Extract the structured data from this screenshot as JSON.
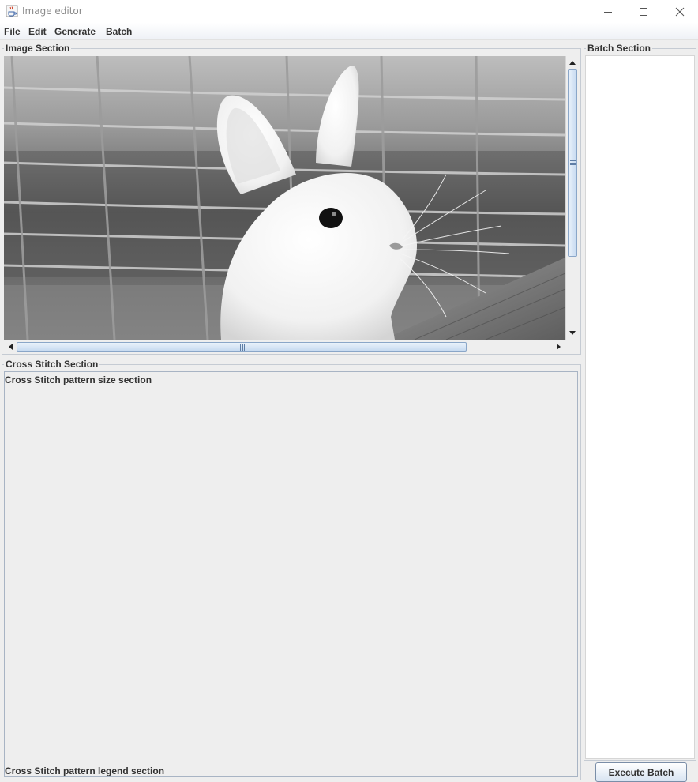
{
  "window": {
    "title": "Image editor",
    "icon": "java-coffee-icon"
  },
  "window_controls": [
    "minimize-icon",
    "maximize-icon",
    "close-icon"
  ],
  "menu": [
    "File",
    "Edit",
    "Generate",
    "Batch"
  ],
  "image_section": {
    "title": "Image Section",
    "image_description": "grayscale-white-rabbit",
    "vertical_scroll": {
      "position": 0.0,
      "visible_fraction": 0.67
    },
    "horizontal_scroll": {
      "position": 0.0,
      "visible_fraction": 0.84
    }
  },
  "cross_stitch_section": {
    "title": "Cross Stitch Section",
    "size_label": "Cross Stitch pattern size section",
    "legend_label": "Cross Stitch pattern legend section"
  },
  "batch_section": {
    "title": "Batch Section",
    "items": [],
    "execute_label": "Execute Batch"
  },
  "colors": {
    "panel_bg": "#eeeeee",
    "scroll_thumb": "#c7daf0",
    "border": "#c5cbd3"
  }
}
